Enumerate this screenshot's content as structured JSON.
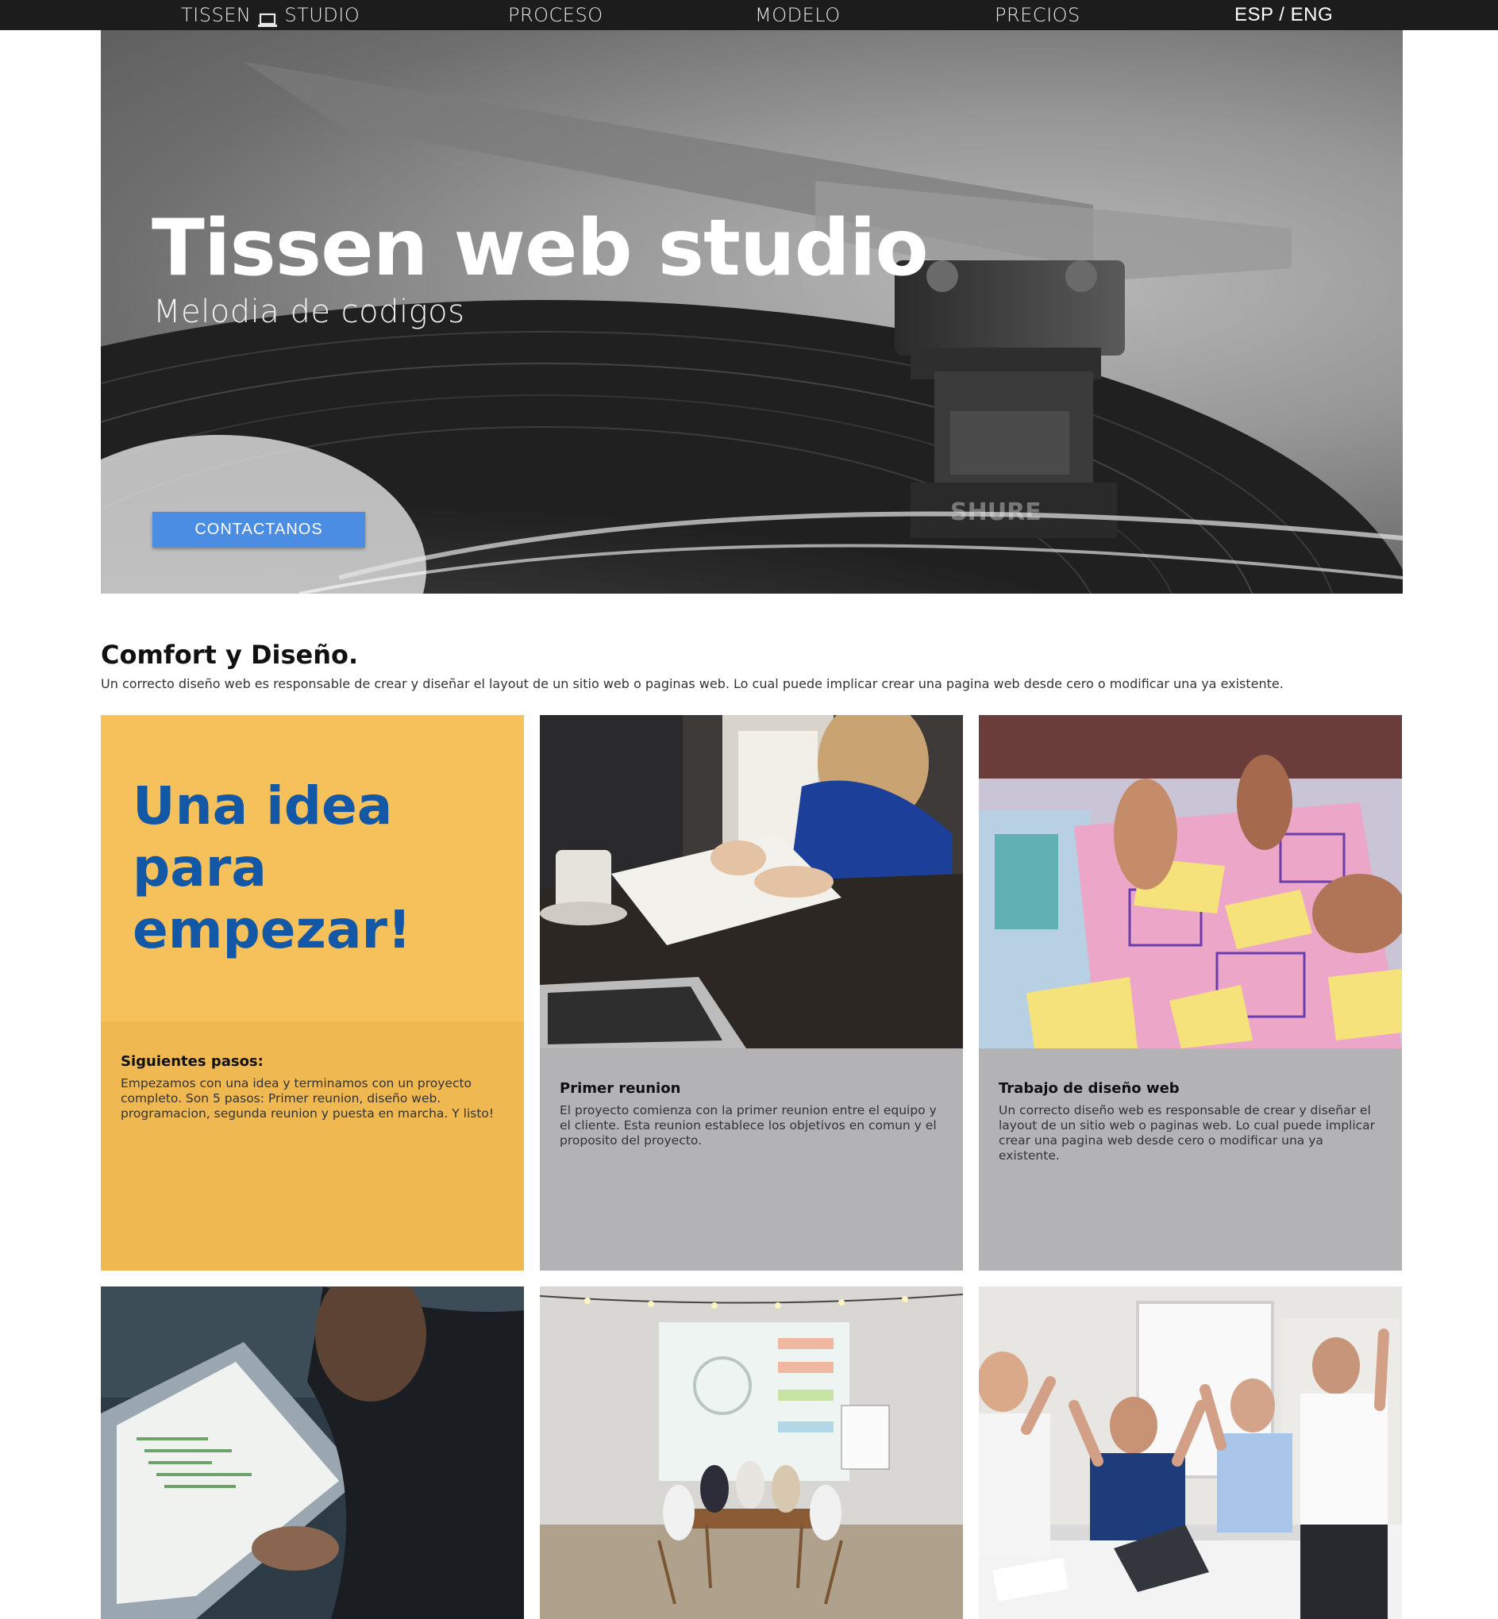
{
  "nav": {
    "brand_left": "TISSEN",
    "brand_right": "STUDIO",
    "brand_icon": "laptop-icon",
    "items": [
      "PROCESO",
      "MODELO",
      "PRECIOS"
    ],
    "lang_esp": "ESP",
    "lang_sep": "/",
    "lang_eng": "ENG"
  },
  "hero": {
    "title": "Tissen web studio",
    "subtitle": "Melodia de codigos",
    "cta": "CONTACTANOS",
    "cta_color": "#4a8de3",
    "image": "turntable-photo"
  },
  "section": {
    "title": "Comfort y Diseño.",
    "description": "Un correcto diseño web es responsable de crear y diseñar el layout de un sitio web o paginas web. Lo cual puede implicar crear una pagina web desde cero o modificar una ya existente."
  },
  "cards": [
    {
      "headline": "Una idea para empezar!",
      "title": "Siguientes pasos:",
      "body": "Empezamos con una idea y terminamos con un proyecto completo. Son 5 pasos: Primer reunion, diseño web. programacion, segunda reunion y puesta en marcha. Y listo!",
      "bg": "#f6c15b",
      "accent": "#1358a6"
    },
    {
      "title": "Primer reunion",
      "body": "El proyecto comienza con la primer reunion entre el equipo y el cliente. Esta reunion establece los objetivos en comun y el proposito del proyecto.",
      "image": "meeting-notebook-photo"
    },
    {
      "title": "Trabajo de diseño web",
      "body": "Un correcto diseño web es responsable de crear y diseñar el layout de un sitio web o paginas web. Lo cual puede implicar crear una pagina web desde cero o modificar una ya existente.",
      "image": "wireframe-sticky-notes-photo"
    }
  ],
  "photo_cards": [
    "programmer-laptop-photo",
    "team-presentation-photo",
    "celebrating-team-photo"
  ]
}
